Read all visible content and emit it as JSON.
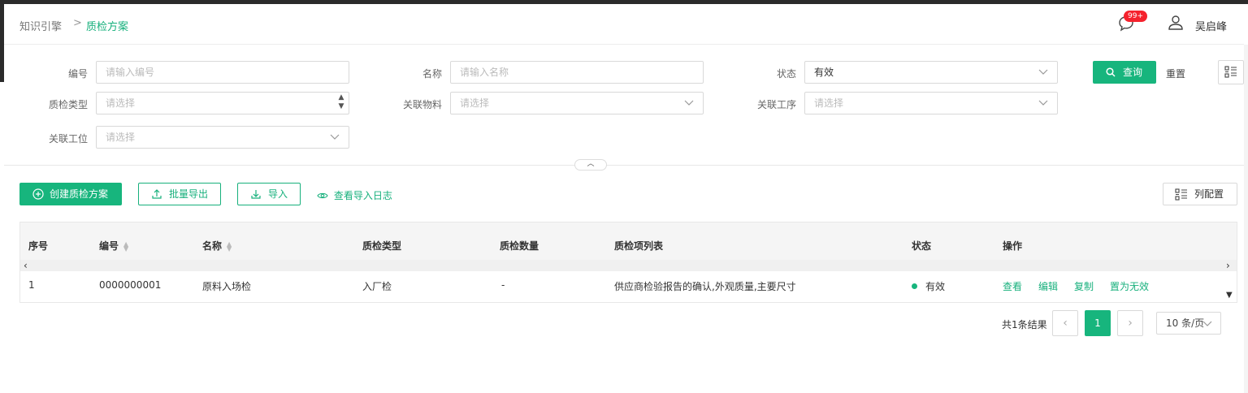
{
  "breadcrumb": {
    "parent": "知识引擎",
    "separator": ">",
    "current": "质检方案"
  },
  "header": {
    "badge": "99+",
    "user_name": "吴启峰"
  },
  "filters": {
    "code_label": "编号",
    "code_placeholder": "请输入编号",
    "name_label": "名称",
    "name_placeholder": "请输入名称",
    "status_label": "状态",
    "status_value": "有效",
    "type_label": "质检类型",
    "type_placeholder": "请选择",
    "material_label": "关联物料",
    "material_placeholder": "请选择",
    "process_label": "关联工序",
    "process_placeholder": "请选择",
    "station_label": "关联工位",
    "station_placeholder": "请选择",
    "query_label": "查询",
    "reset_label": "重置"
  },
  "toolbar": {
    "create_label": "创建质检方案",
    "export_label": "批量导出",
    "import_label": "导入",
    "log_label": "查看导入日志",
    "colcfg_label": "列配置"
  },
  "table": {
    "columns": [
      "序号",
      "编号",
      "名称",
      "质检类型",
      "质检数量",
      "质检项列表",
      "状态",
      "操作"
    ],
    "rows": [
      {
        "index": "1",
        "code": "0000000001",
        "name": "原料入场检",
        "type": "入厂检",
        "count": "-",
        "items": "供应商检验报告的确认,外观质量,主要尺寸",
        "status": "有效",
        "actions": [
          "查看",
          "编辑",
          "复制",
          "置为无效"
        ]
      }
    ]
  },
  "pagination": {
    "total": "共1条结果",
    "current": "1",
    "page_size": "10 条/页"
  },
  "colors": {
    "accent": "#17b57d",
    "badge": "#f5222d"
  }
}
